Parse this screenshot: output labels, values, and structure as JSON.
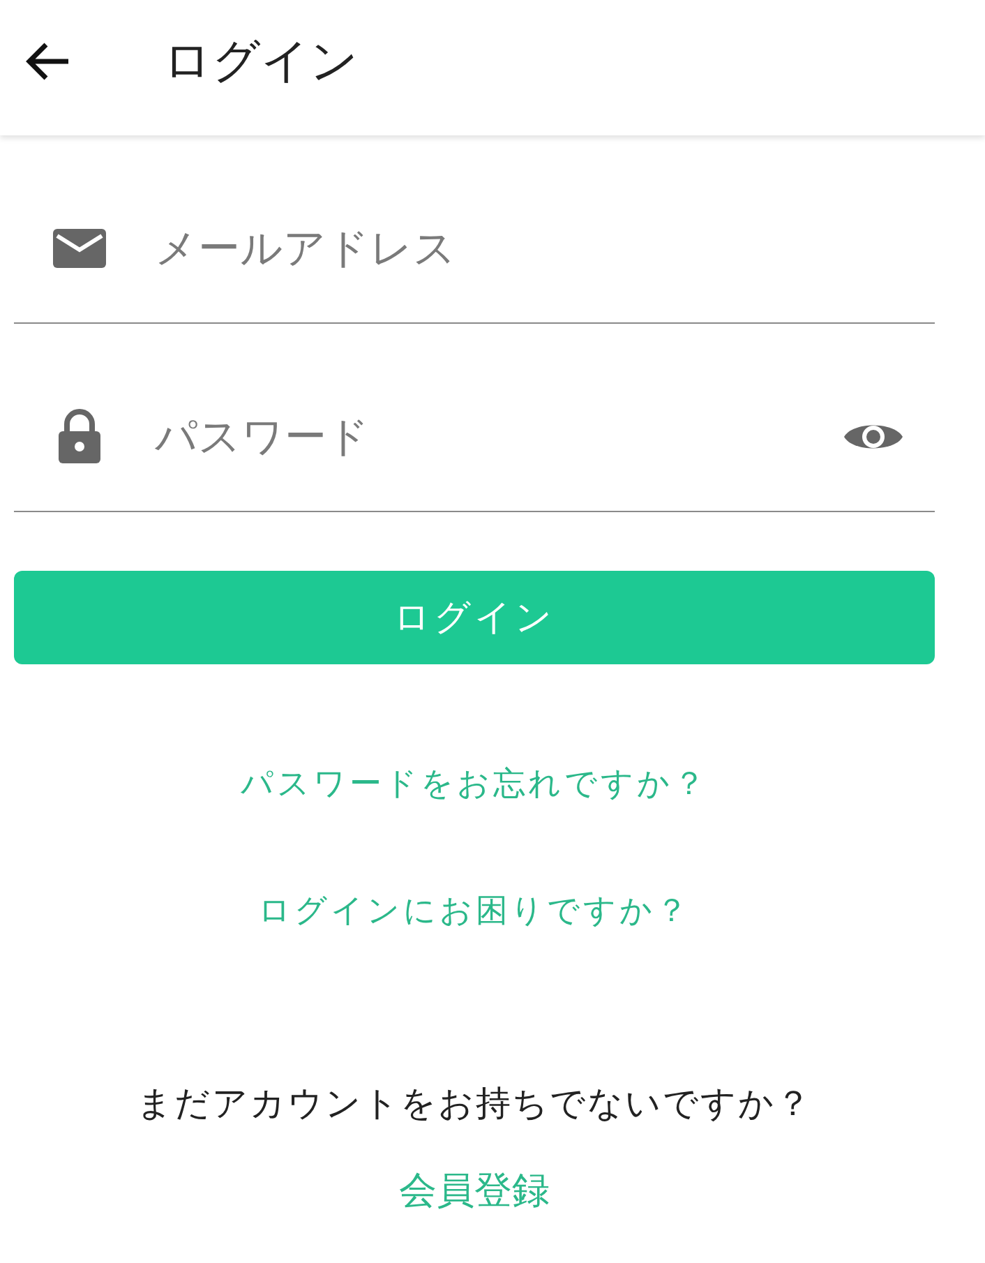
{
  "header": {
    "title": "ログイン"
  },
  "form": {
    "email": {
      "placeholder": "メールアドレス"
    },
    "password": {
      "placeholder": "パスワード"
    },
    "login_button": "ログイン"
  },
  "links": [
    "パスワードをお忘れですか？",
    "ログインにお困りですか？"
  ],
  "signup": {
    "prompt": "まだアカウントをお持ちでないですか？",
    "link": "会員登録"
  }
}
